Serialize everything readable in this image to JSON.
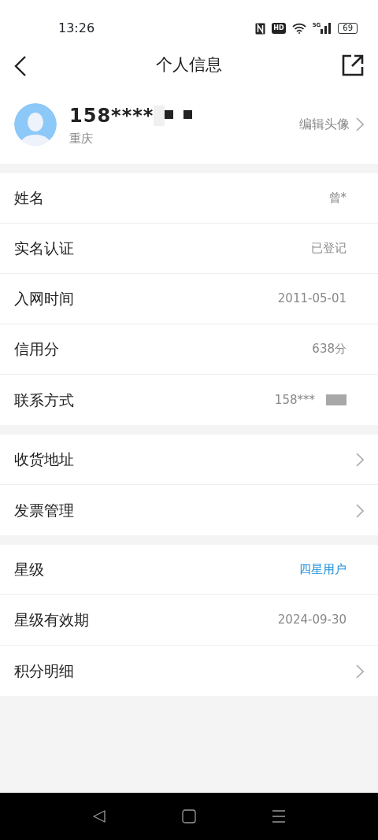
{
  "status_bar": {
    "time": "13:26",
    "hd": "HD",
    "network": "5G",
    "battery": "69"
  },
  "header": {
    "title": "个人信息"
  },
  "profile": {
    "phone": "158****",
    "city": "重庆",
    "edit_label": "编辑头像"
  },
  "groups": [
    {
      "rows": [
        {
          "label": "姓名",
          "value": "曾*",
          "kind": "value"
        },
        {
          "label": "实名认证",
          "value": "已登记",
          "kind": "value"
        },
        {
          "label": "入网时间",
          "value": "2011-05-01",
          "kind": "value"
        },
        {
          "label": "信用分",
          "value": "638分",
          "kind": "value"
        },
        {
          "label": "联系方式",
          "value": "158***",
          "kind": "masked"
        }
      ]
    },
    {
      "rows": [
        {
          "label": "收货地址",
          "kind": "link"
        },
        {
          "label": "发票管理",
          "kind": "link"
        }
      ]
    },
    {
      "rows": [
        {
          "label": "星级",
          "value": "四星用户",
          "kind": "highlight"
        },
        {
          "label": "星级有效期",
          "value": "2024-09-30",
          "kind": "value"
        },
        {
          "label": "积分明细",
          "kind": "link"
        }
      ]
    }
  ]
}
